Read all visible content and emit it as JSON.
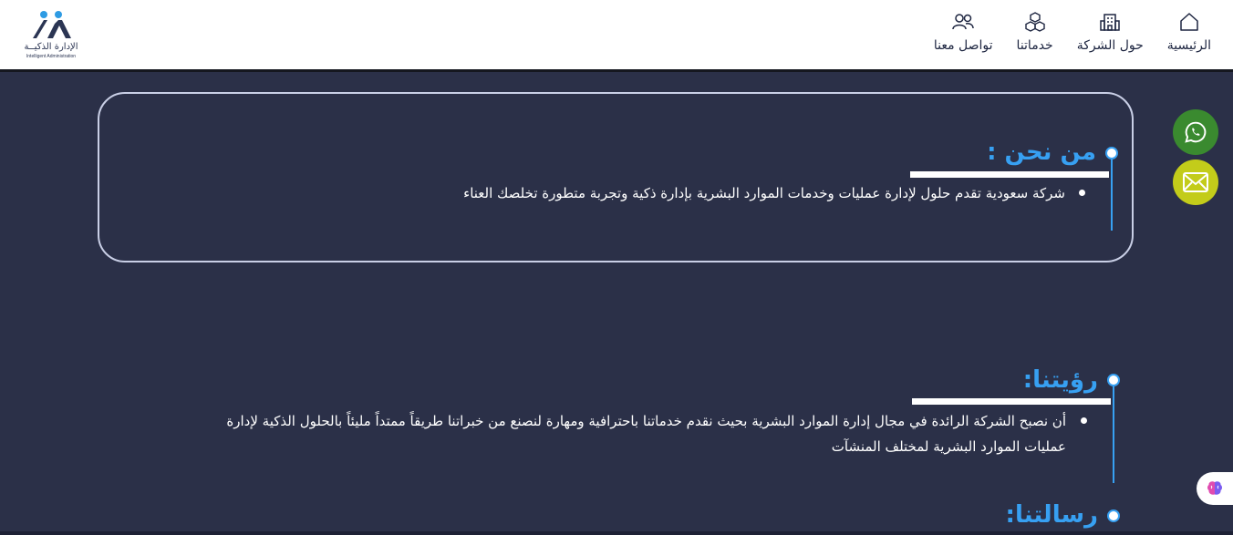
{
  "header": {
    "logo": {
      "name_ar": "الإدارة الذكيــة",
      "name_en": "Intelligent Administration"
    },
    "nav": [
      {
        "label": "الرئيسية",
        "icon": "home-icon"
      },
      {
        "label": "حول الشركة",
        "icon": "building-icon"
      },
      {
        "label": "خدماتنا",
        "icon": "cubes-icon"
      },
      {
        "label": "تواصل معنا",
        "icon": "users-icon"
      }
    ]
  },
  "sections": {
    "about": {
      "title": "من نحن :",
      "text": "شركة سعودية تقدم حلول لإدارة عمليات وخدمات الموارد البشرية بإدارة ذكية وتجربة متطورة تخلصك العناء"
    },
    "vision": {
      "title": "رؤيتنا:",
      "text": "أن نصبح الشركة الرائدة في مجال إدارة الموارد البشرية بحيث نقدم خدماتنا باحترافية ومهارة لنصنع من خبراتنا طريقاً ممتداً مليئاً بالحلول الذكية لإدارة عمليات الموارد البشرية لمختلف المنشآت"
    },
    "mission": {
      "title": "رسالتنا:"
    }
  },
  "floating": {
    "whatsapp_icon": "whatsapp-icon",
    "mail_icon": "mail-icon",
    "assistant_icon": "brain-icon"
  },
  "colors": {
    "background": "#2b3048",
    "accent": "#37a0f2",
    "whatsapp": "#3a8a2f",
    "mail": "#c3cc1a"
  }
}
